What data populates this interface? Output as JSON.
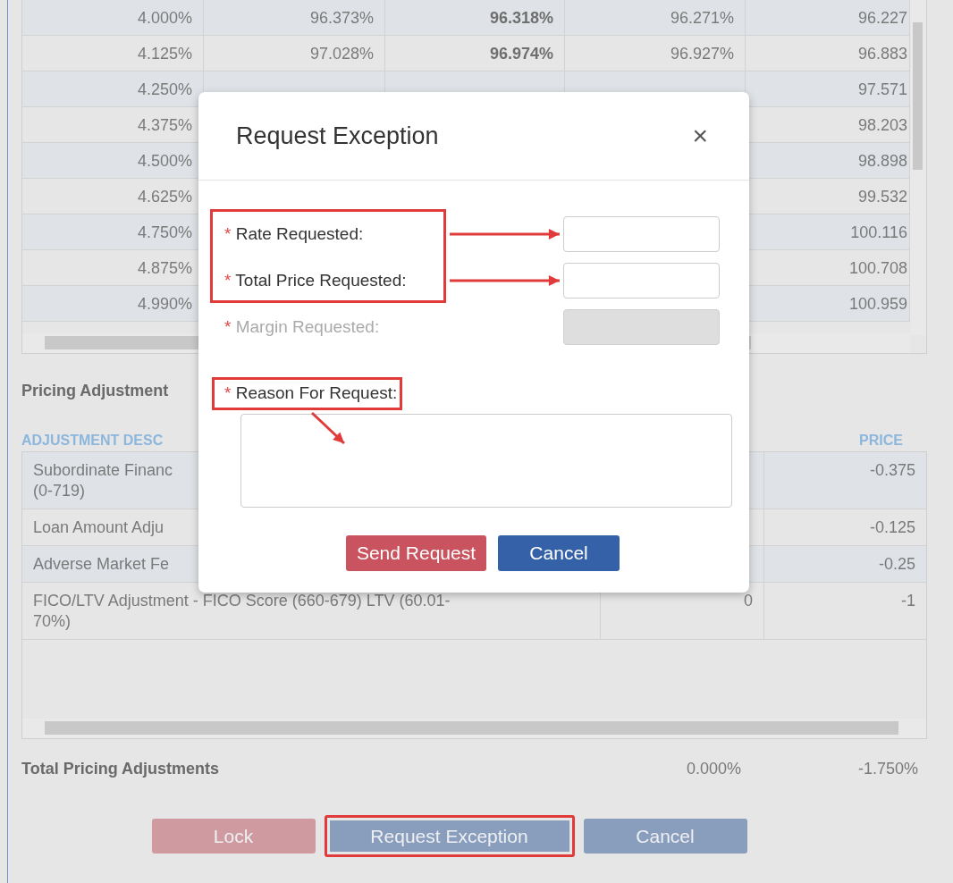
{
  "rate_table": {
    "rows": [
      {
        "cells": [
          "4.000%",
          "96.373%",
          "96.318%",
          "96.271%",
          "96.227"
        ]
      },
      {
        "cells": [
          "4.125%",
          "97.028%",
          "96.974%",
          "96.927%",
          "96.883"
        ]
      },
      {
        "cells": [
          "4.250%",
          null,
          null,
          null,
          "97.571"
        ]
      },
      {
        "cells": [
          "4.375%",
          null,
          null,
          null,
          "98.203"
        ]
      },
      {
        "cells": [
          "4.500%",
          null,
          null,
          null,
          "98.898"
        ]
      },
      {
        "cells": [
          "4.625%",
          null,
          null,
          null,
          "99.532"
        ]
      },
      {
        "cells": [
          "4.750%",
          null,
          null,
          null,
          "100.116"
        ]
      },
      {
        "cells": [
          "4.875%",
          null,
          null,
          null,
          "100.708"
        ]
      },
      {
        "cells": [
          "4.990%",
          null,
          null,
          null,
          "100.959"
        ]
      }
    ]
  },
  "pricing_adjustments": {
    "title": "Pricing Adjustment",
    "columns": [
      "ADJUSTMENT DESC",
      null,
      "PRICE"
    ],
    "rows": [
      {
        "cells": [
          "Subordinate Financ\n(0-719)",
          null,
          "-0.375"
        ]
      },
      {
        "cells": [
          "Loan Amount Adju",
          null,
          "-0.125"
        ]
      },
      {
        "cells": [
          "Adverse Market Fe",
          null,
          "-0.25"
        ]
      },
      {
        "cells": [
          "FICO/LTV Adjustment - FICO Score (660-679) LTV (60.01-70%)",
          "0",
          "-1"
        ]
      }
    ],
    "total": {
      "label": "Total Pricing Adjustments",
      "rate": "0.000%",
      "price": "-1.750%"
    }
  },
  "actions": [
    {
      "label": "Lock",
      "kind": "danger",
      "highlighted": false
    },
    {
      "label": "Request Exception",
      "kind": "primary",
      "highlighted": true
    },
    {
      "label": "Cancel",
      "kind": "primary",
      "highlighted": false
    }
  ],
  "modal": {
    "title": "Request Exception",
    "close": "×",
    "fields": [
      {
        "label": "Rate Requested:",
        "required": "*",
        "disabled": false,
        "highlighted": true
      },
      {
        "label": "Total Price Requested:",
        "required": "*",
        "disabled": false,
        "highlighted": true
      },
      {
        "label": "Margin Requested:",
        "required": "*",
        "disabled": true,
        "highlighted": false
      }
    ],
    "reason": {
      "label": "Reason For Request:",
      "required": "*",
      "highlighted": true
    },
    "buttons": [
      {
        "label": "Send Request",
        "kind": "danger"
      },
      {
        "label": "Cancel",
        "kind": "primary"
      }
    ]
  }
}
